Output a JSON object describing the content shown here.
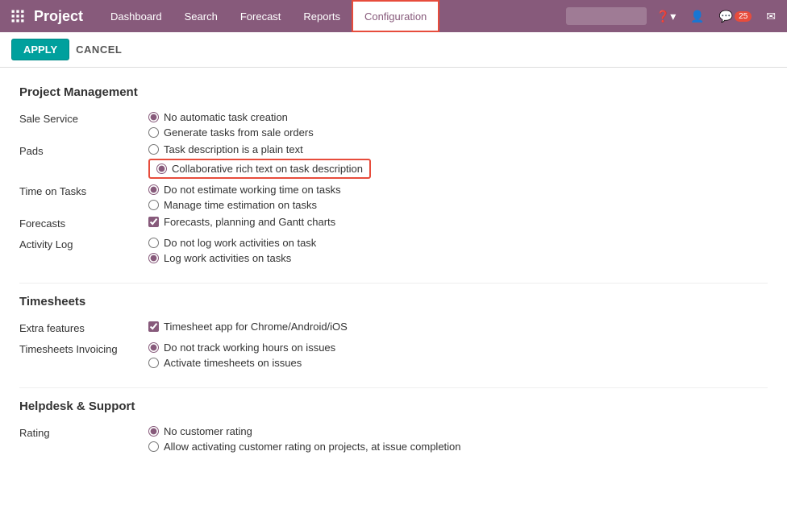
{
  "app": {
    "title": "Project",
    "nav": [
      {
        "label": "Dashboard",
        "active": false
      },
      {
        "label": "Search",
        "active": false
      },
      {
        "label": "Forecast",
        "active": false
      },
      {
        "label": "Reports",
        "active": false
      },
      {
        "label": "Configuration",
        "active": true
      }
    ],
    "search_placeholder": "",
    "notifications_count": "25"
  },
  "action_bar": {
    "apply_label": "APPLY",
    "cancel_label": "CANCEL"
  },
  "sections": [
    {
      "title": "Project Management",
      "fields": [
        {
          "label": "Sale Service",
          "options": [
            {
              "type": "radio",
              "label": "No automatic task creation",
              "checked": true,
              "highlighted": false
            },
            {
              "type": "radio",
              "label": "Generate tasks from sale orders",
              "checked": false,
              "highlighted": false
            }
          ]
        },
        {
          "label": "Pads",
          "options": [
            {
              "type": "radio",
              "label": "Task description is a plain text",
              "checked": false,
              "highlighted": false
            },
            {
              "type": "radio",
              "label": "Collaborative rich text on task description",
              "checked": true,
              "highlighted": true
            }
          ]
        },
        {
          "label": "Time on Tasks",
          "options": [
            {
              "type": "radio",
              "label": "Do not estimate working time on tasks",
              "checked": true,
              "highlighted": false
            },
            {
              "type": "radio",
              "label": "Manage time estimation on tasks",
              "checked": false,
              "highlighted": false
            }
          ]
        },
        {
          "label": "Forecasts",
          "options": [
            {
              "type": "checkbox",
              "label": "Forecasts, planning and Gantt charts",
              "checked": true,
              "highlighted": false
            }
          ]
        },
        {
          "label": "Activity Log",
          "options": [
            {
              "type": "radio",
              "label": "Do not log work activities on task",
              "checked": false,
              "highlighted": false
            },
            {
              "type": "radio",
              "label": "Log work activities on tasks",
              "checked": true,
              "highlighted": false
            }
          ]
        }
      ]
    },
    {
      "title": "Timesheets",
      "fields": [
        {
          "label": "Extra features",
          "options": [
            {
              "type": "checkbox",
              "label": "Timesheet app for Chrome/Android/iOS",
              "checked": true,
              "highlighted": false
            }
          ]
        },
        {
          "label": "Timesheets Invoicing",
          "options": [
            {
              "type": "radio",
              "label": "Do not track working hours on issues",
              "checked": true,
              "highlighted": false
            },
            {
              "type": "radio",
              "label": "Activate timesheets on issues",
              "checked": false,
              "highlighted": false
            }
          ]
        }
      ]
    },
    {
      "title": "Helpdesk & Support",
      "fields": [
        {
          "label": "Rating",
          "options": [
            {
              "type": "radio",
              "label": "No customer rating",
              "checked": true,
              "highlighted": false
            },
            {
              "type": "radio",
              "label": "Allow activating customer rating on projects, at issue completion",
              "checked": false,
              "highlighted": false
            }
          ]
        }
      ]
    }
  ]
}
